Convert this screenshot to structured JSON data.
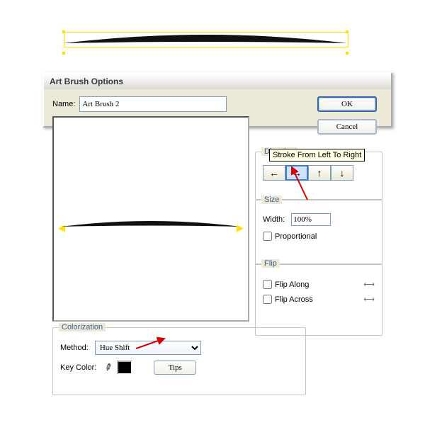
{
  "dialog": {
    "title": "Art Brush Options",
    "name_label": "Name:",
    "name_value": "Art Brush 2",
    "ok": "OK",
    "cancel": "Cancel"
  },
  "direction": {
    "legend": "Direction",
    "buttons": [
      "←",
      "→",
      "↑",
      "↓"
    ],
    "tooltip": "Stroke From Left To Right"
  },
  "size": {
    "legend": "Size",
    "width_label": "Width:",
    "width_value": "100%",
    "proportional": "Proportional"
  },
  "flip": {
    "legend": "Flip",
    "along": "Flip Along",
    "across": "Flip Across"
  },
  "coloriz": {
    "legend": "Colorization",
    "method_label": "Method:",
    "method_value": "Hue Shift",
    "keycolor_label": "Key Color:",
    "tips": "Tips"
  }
}
